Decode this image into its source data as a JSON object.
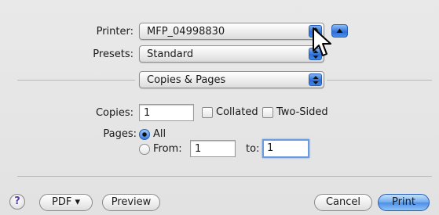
{
  "printer": {
    "label": "Printer:",
    "value": "MFP_04998830"
  },
  "presets": {
    "label": "Presets:",
    "value": "Standard"
  },
  "section": {
    "value": "Copies & Pages"
  },
  "copies": {
    "label": "Copies:",
    "value": "1",
    "collated_label": "Collated",
    "two_sided_label": "Two-Sided",
    "collated_checked": false,
    "two_sided_checked": false
  },
  "pages": {
    "label": "Pages:",
    "all_label": "All",
    "from_label": "From:",
    "from_value": "1",
    "to_label": "to:",
    "to_value": "1",
    "selected": "All"
  },
  "footer": {
    "help_glyph": "?",
    "pdf_label": "PDF ▾",
    "preview_label": "Preview",
    "cancel_label": "Cancel",
    "print_label": "Print"
  },
  "icons": {
    "popup_arrows": "up-down-arrows-icon",
    "disclosure": "disclosure-triangle-icon",
    "cursor": "mouse-pointer-icon"
  },
  "colors": {
    "accent": "#3c7fe0",
    "background": "#e4e4e4"
  }
}
